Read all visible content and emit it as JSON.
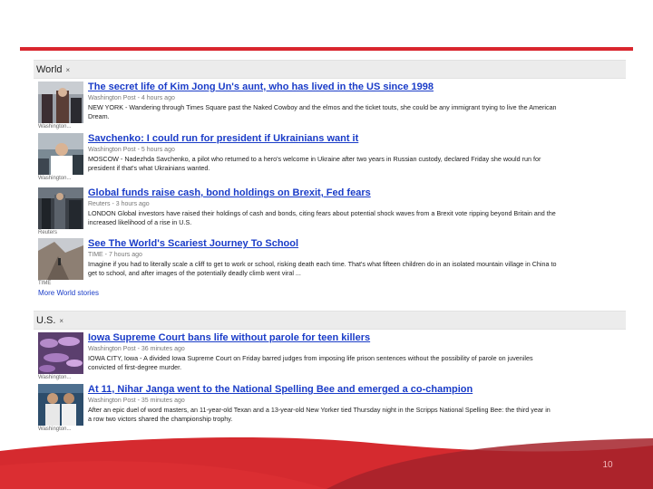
{
  "slide": {
    "page_number": "10"
  },
  "world": {
    "header": "World",
    "more_link": "More World stories",
    "stories": [
      {
        "headline": "The secret life of Kim Jong Un's aunt, who has lived in the US since 1998",
        "meta": "Washington Post - 4 hours ago",
        "snippet_1": "NEW YORK - Wandering through Times Square past the Naked Cowboy and the elmos and the ticket touts, she could be any immigrant trying to live the American",
        "snippet_2": "Dream.",
        "thumb_source": "Washington..."
      },
      {
        "headline": "Savchenko: I could run for president if Ukrainians want it",
        "meta": "Washington Post - 5 hours ago",
        "snippet_1": "MOSCOW - Nadezhda Savchenko, a pilot who returned to a hero's welcome in Ukraine after two years in Russian custody, declared Friday she would run for",
        "snippet_2": "president if that's what Ukrainians wanted.",
        "thumb_source": "Washington..."
      },
      {
        "headline": "Global funds raise cash, bond holdings on Brexit, Fed fears",
        "meta": "Reuters - 3 hours ago",
        "snippet_1": "LONDON Global investors have raised their holdings of cash and bonds, citing fears about potential shock waves from a Brexit vote ripping beyond Britain and the",
        "snippet_2": "increased likelihood of a rise in U.S.",
        "thumb_source": "Reuters"
      },
      {
        "headline": "See The World's Scariest Journey To School",
        "meta": "TIME - 7 hours ago",
        "snippet_1": "Imagine if you had to literally scale a cliff to get to work or school, risking death each time. That's what fifteen children do in an isolated mountain village in China to",
        "snippet_2": "get to school, and after images of the potentially deadly climb went viral ...",
        "thumb_source": "TIME"
      }
    ]
  },
  "us": {
    "header": "U.S.",
    "stories": [
      {
        "headline": "Iowa Supreme Court bans life without parole for teen killers",
        "meta": "Washington Post - 36 minutes ago",
        "snippet_1": "IOWA CITY, Iowa - A divided Iowa Supreme Court on Friday barred judges from imposing life prison sentences without the possibility of parole on juveniles",
        "snippet_2": "convicted of first-degree murder.",
        "thumb_source": "Washington..."
      },
      {
        "headline": "At 11, Nihar Janga went to the National Spelling Bee and emerged a co-champion",
        "meta": "Washington Post - 35 minutes ago",
        "snippet_1": "After an epic duel of word masters, an 11-year-old Texan and a 13-year-old New Yorker tied Thursday night in the Scripps National Spelling Bee: the third year in",
        "snippet_2": "a row two victors shared the championship trophy.",
        "thumb_source": "Washington..."
      }
    ]
  },
  "colors": {
    "accent_red": "#d9262e",
    "link_blue": "#1a3cc8",
    "footer_dark": "#b8262c"
  }
}
